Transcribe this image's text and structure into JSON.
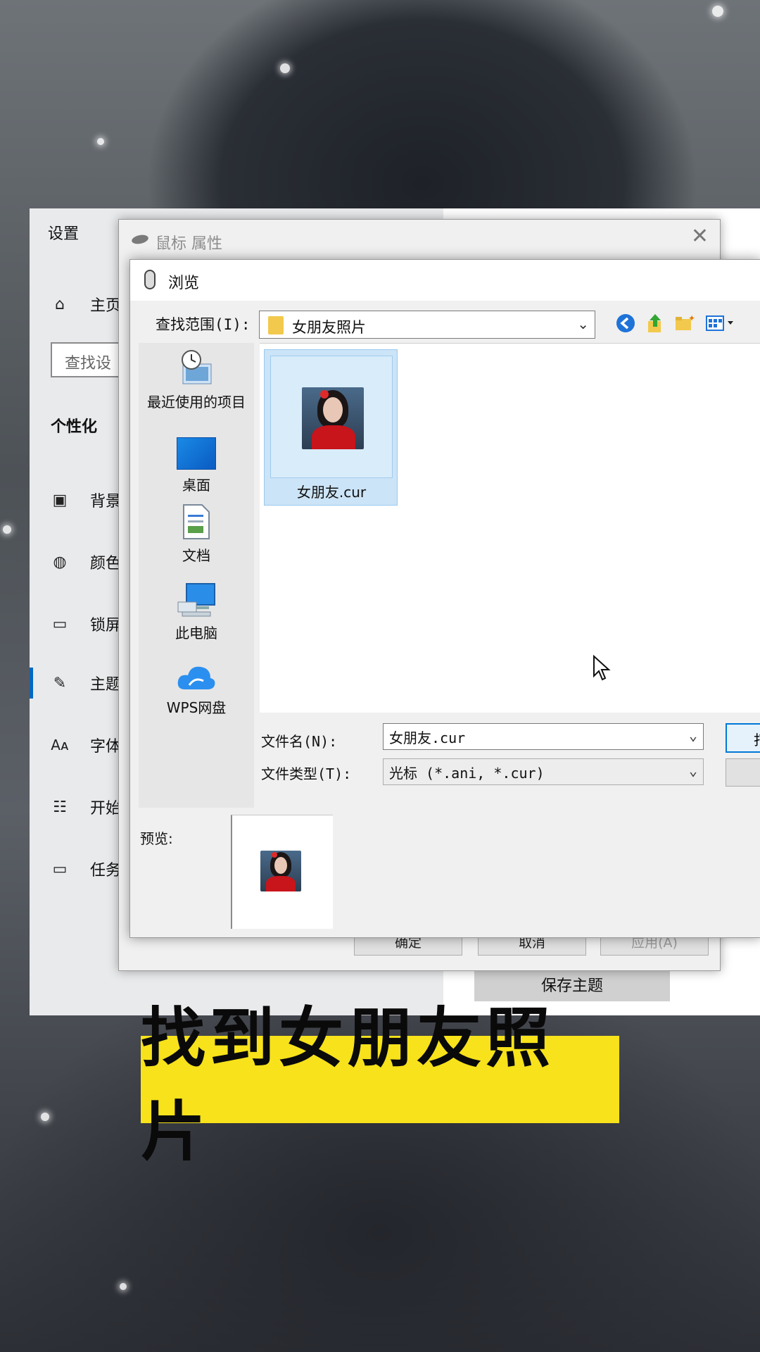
{
  "settings": {
    "title": "设置",
    "home_label": "主页",
    "search_placeholder": "查找设",
    "section": "个性化",
    "nav": [
      {
        "label": "背景",
        "icon": "picture-icon"
      },
      {
        "label": "颜色",
        "icon": "palette-icon"
      },
      {
        "label": "锁屏",
        "icon": "lock-screen-icon"
      },
      {
        "label": "主题",
        "icon": "theme-brush-icon"
      },
      {
        "label": "字体",
        "icon": "font-icon"
      },
      {
        "label": "开始",
        "icon": "start-grid-icon"
      },
      {
        "label": "任务",
        "icon": "taskbar-icon"
      }
    ],
    "save_theme": "保存主题"
  },
  "mouse_dialog": {
    "title": "鼠标 属性",
    "ok": "确定",
    "cancel": "取消",
    "apply": "应用(A)"
  },
  "browse": {
    "title": "浏览",
    "lookin_label": "查找范围(I):",
    "lookin_value": "女朋友照片",
    "places": [
      {
        "label": "最近使用的项目",
        "icon": "recent-items-icon"
      },
      {
        "label": "桌面",
        "icon": "desktop-icon"
      },
      {
        "label": "文档",
        "icon": "documents-icon"
      },
      {
        "label": "此电脑",
        "icon": "this-pc-icon"
      },
      {
        "label": "WPS网盘",
        "icon": "wps-cloud-icon"
      }
    ],
    "file_name": "女朋友.cur",
    "filename_label": "文件名(N):",
    "filename_value": "女朋友.cur",
    "filetype_label": "文件类型(T):",
    "filetype_value": "光标 (*.ani, *.cur)",
    "open_button": "打",
    "preview_label": "预览:"
  },
  "caption": "找到女朋友照片",
  "colors": {
    "caption_bg": "#f7e21b",
    "selection": "#cce4f7",
    "accent": "#0078d7"
  }
}
